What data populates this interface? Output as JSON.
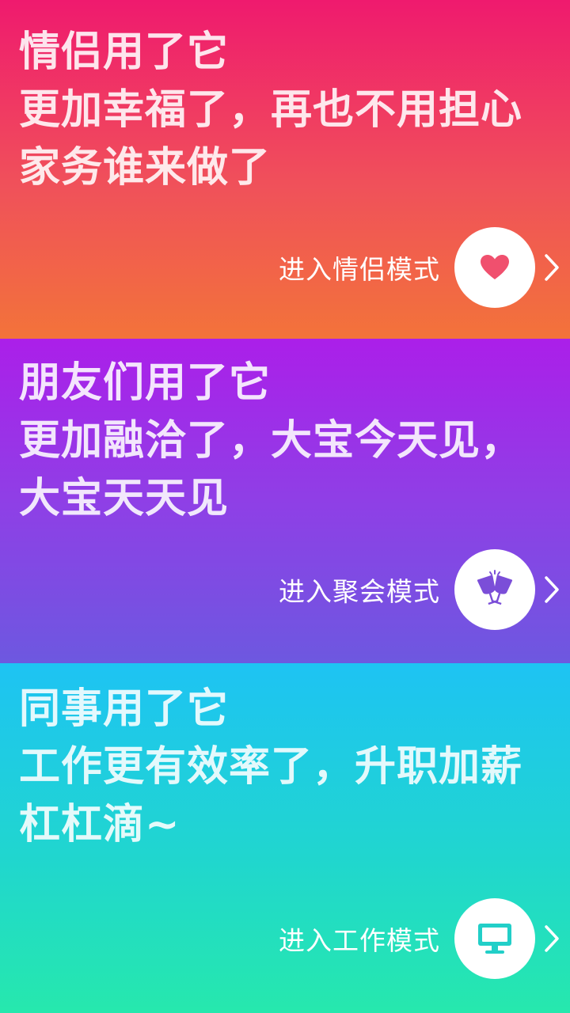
{
  "modes": [
    {
      "headline_lines": [
        "情侣用了它",
        "更加幸福了，再也不用担心",
        "家务谁来做了"
      ],
      "button_label": "进入情侣模式",
      "icon": "heart-icon",
      "icon_color": "#f0506e"
    },
    {
      "headline_lines": [
        "朋友们用了它",
        "更加融洽了，大宝今天见，",
        "大宝天天见"
      ],
      "button_label": "进入聚会模式",
      "icon": "cheers-glasses-icon",
      "icon_color": "#7b4ed8"
    },
    {
      "headline_lines": [
        "同事用了它",
        "工作更有效率了，升职加薪",
        "杠杠滴~"
      ],
      "button_label": "进入工作模式",
      "icon": "monitor-icon",
      "icon_color": "#22cfc8"
    }
  ]
}
